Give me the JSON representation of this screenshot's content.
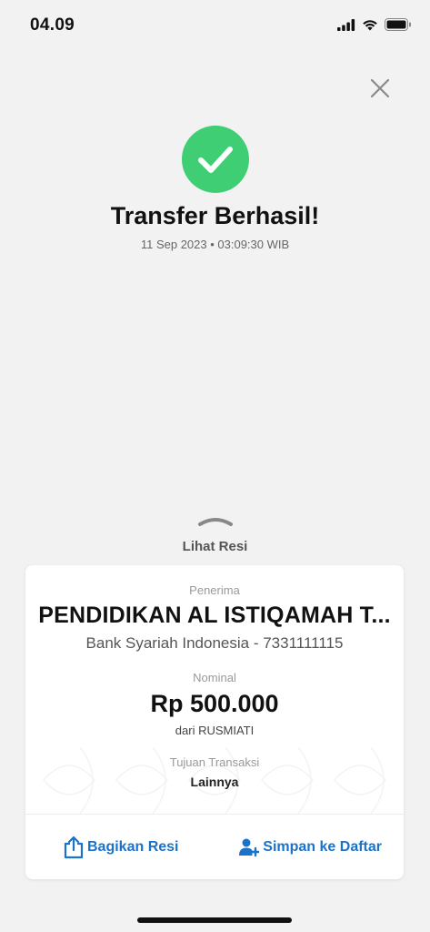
{
  "status_bar": {
    "time": "04.09",
    "icons": [
      "cellular-signal-icon",
      "wifi-icon",
      "battery-icon"
    ]
  },
  "close": {
    "icon": "close-icon"
  },
  "result": {
    "icon": "check-circle-icon",
    "title": "Transfer Berhasil!",
    "datetime": "11 Sep 2023 • 03:09:30 WIB"
  },
  "resi_toggle": {
    "icon": "chevron-up-icon",
    "label": "Lihat Resi"
  },
  "receipt": {
    "recipient_label": "Penerima",
    "recipient_name": "PENDIDIKAN AL ISTIQAMAH T...",
    "recipient_bank": "Bank Syariah Indonesia - 7331111115",
    "nominal_label": "Nominal",
    "amount": "Rp 500.000",
    "sender": "dari RUSMIATI",
    "purpose_label": "Tujuan Transaksi",
    "purpose": "Lainnya"
  },
  "actions": {
    "share_label": "Bagikan Resi",
    "share_icon": "share-icon",
    "save_label": "Simpan ke Daftar",
    "save_icon": "add-person-icon"
  },
  "colors": {
    "success": "#3fce74",
    "accent": "#1a73c9",
    "background": "#f2f2f2"
  }
}
